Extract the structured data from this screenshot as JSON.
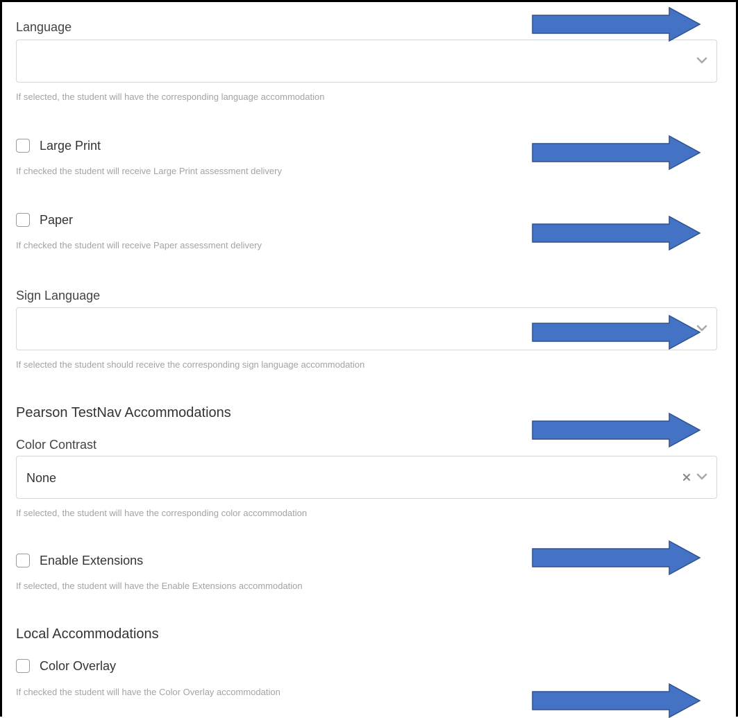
{
  "colors": {
    "arrow_fill": "#4472c4",
    "arrow_stroke": "#2f528f",
    "help_text": "#a3a3a3",
    "border": "#d6d6d6"
  },
  "language": {
    "label": "Language",
    "value": "",
    "help": "If selected, the student will have the corresponding language accommodation"
  },
  "large_print": {
    "label": "Large Print",
    "checked": false,
    "help": "If checked the student will receive Large Print assessment delivery"
  },
  "paper": {
    "label": "Paper",
    "checked": false,
    "help": "If checked the student will receive Paper assessment delivery"
  },
  "sign_language": {
    "label": "Sign Language",
    "value": "",
    "help": "If selected the student should receive the corresponding sign language accommodation"
  },
  "pearson": {
    "title": "Pearson TestNav Accommodations",
    "color_contrast": {
      "label": "Color Contrast",
      "value": "None",
      "help": "If selected, the student will have the corresponding color accommodation"
    },
    "enable_extensions": {
      "label": "Enable Extensions",
      "checked": false,
      "help": "If selected, the student will have the Enable Extensions accommodation"
    }
  },
  "local": {
    "title": "Local Accommodations",
    "color_overlay": {
      "label": "Color Overlay",
      "checked": false,
      "help": "If checked the student will have the Color Overlay accommodation"
    }
  },
  "icons": {
    "dropdown": "chevron-down-icon",
    "clear": "close-icon",
    "callout": "arrow-right-icon"
  }
}
